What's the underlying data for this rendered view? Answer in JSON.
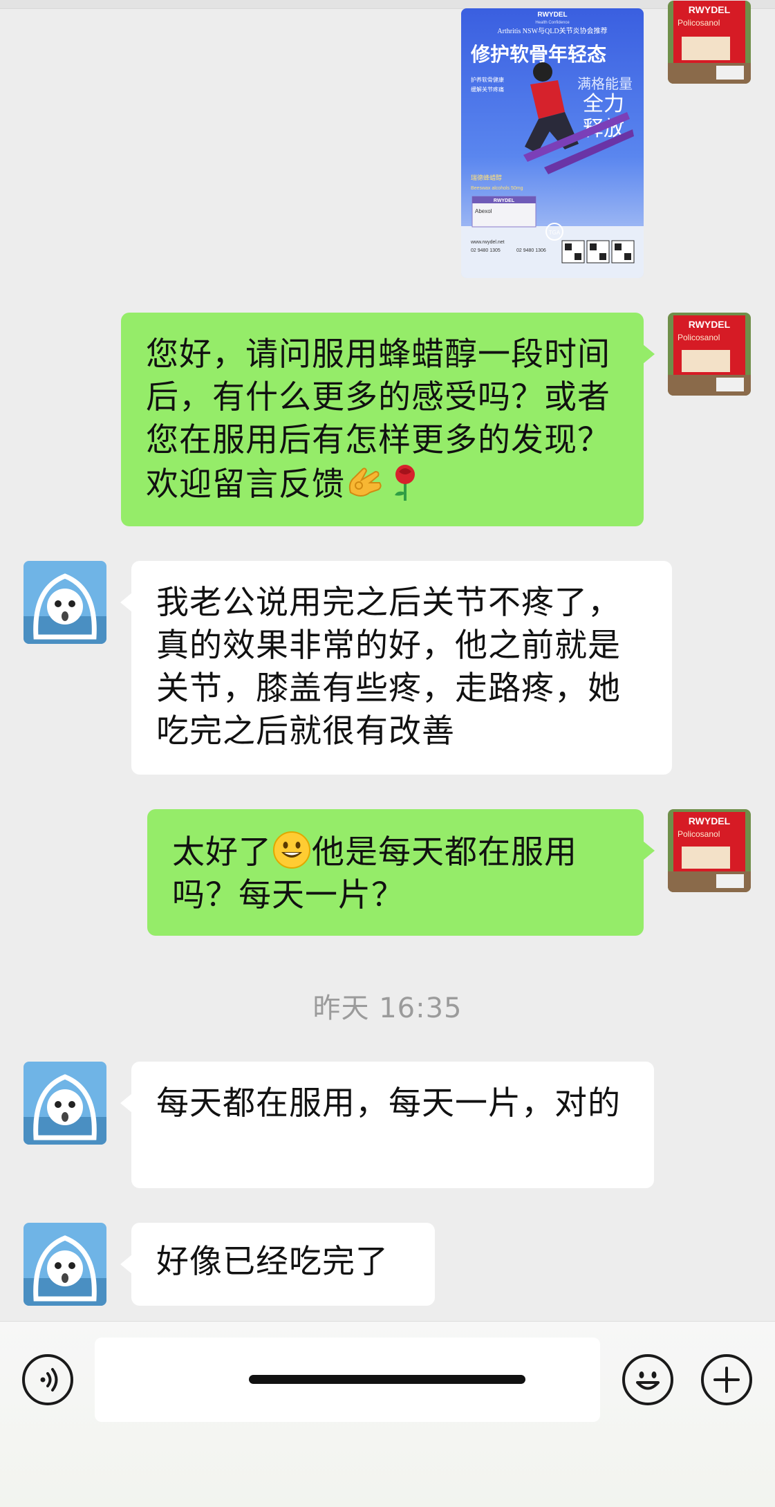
{
  "chat": {
    "messages": [
      {
        "sender": "self",
        "type": "image",
        "poster": {
          "brand": "RWYDEL",
          "tagline": "Health Confidence",
          "endorsement": "Arthritis NSW与QLD关节炎协会推荐",
          "headline": "修护软骨年轻态",
          "sub1": "满格能量",
          "sub2": "全力",
          "sub3": "释放",
          "bullet1": "护养软骨健康",
          "bullet2": "缓解关节疼痛",
          "product_cn": "瑞德蜂蜡醇",
          "product_en": "Beeswax alcohols 50mg",
          "box_brand": "RWYDEL",
          "box_name": "Abexol",
          "website": "www.rwydel.net",
          "phone1": "02 9480 1305",
          "phone2": "02 9480 1306",
          "tga": "TGA"
        }
      },
      {
        "sender": "self",
        "type": "text",
        "text": "您好，请问服用蜂蜡醇一段时间后，有什么更多的感受吗？或者您在服用后有怎样更多的发现？欢迎留言反馈"
      },
      {
        "sender": "other",
        "type": "text",
        "text": "我老公说用完之后关节不疼了，真的效果非常的好，他之前就是关节，膝盖有些疼，走路疼，她吃完之后就很有改善"
      },
      {
        "sender": "self",
        "type": "text",
        "text_before_emoji": "太好了",
        "text_after_emoji": "他是每天都在服用吗？每天一片？"
      },
      {
        "sender": "other",
        "type": "text",
        "text": "每天都在服用，每天一片，对的"
      },
      {
        "sender": "other",
        "type": "text",
        "text": "好像已经吃完了"
      }
    ],
    "timestamp": "昨天 16:35"
  },
  "self_avatar": {
    "brand": "RWYDEL",
    "product": "Policosanol"
  },
  "emojis": [
    "ok-hand-emoji",
    "rose-emoji",
    "grinning-emoji"
  ],
  "input_bar": {
    "voice_icon": "voice-icon",
    "emoji_icon": "smiley-icon",
    "plus_icon": "plus-icon",
    "input_value": ""
  },
  "colors": {
    "background": "#ededed",
    "self_bubble": "#95ec69",
    "other_bubble": "#ffffff",
    "timestamp": "#9b9b9b",
    "brand_red": "#c8141e"
  }
}
